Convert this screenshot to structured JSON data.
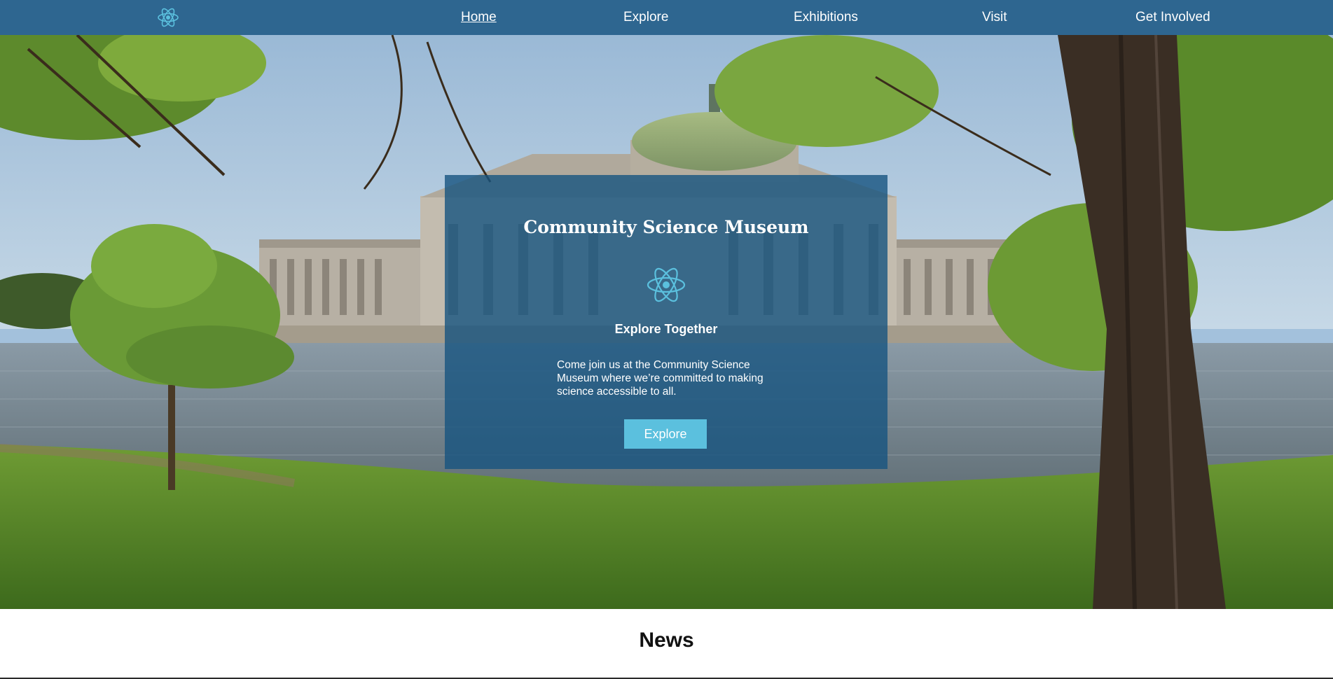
{
  "nav": {
    "logo_icon": "atom-icon",
    "links": [
      {
        "label": "Home",
        "active": true
      },
      {
        "label": "Explore",
        "active": false
      },
      {
        "label": "Exhibitions",
        "active": false
      },
      {
        "label": "Visit",
        "active": false
      },
      {
        "label": "Get Involved",
        "active": false
      }
    ]
  },
  "hero": {
    "background": "museum-building-lake-photo",
    "title": "Community Science Museum",
    "icon": "atom-icon",
    "subtitle": "Explore Together",
    "body": "Come join us at the Community Science Museum where we’re committed to making science accessible to all.",
    "button_label": "Explore"
  },
  "news": {
    "title": "News"
  },
  "colors": {
    "nav_background": "#2e6690",
    "card_background": "#175480",
    "button_background": "#5bc0de",
    "icon_color": "#5bc0de"
  }
}
